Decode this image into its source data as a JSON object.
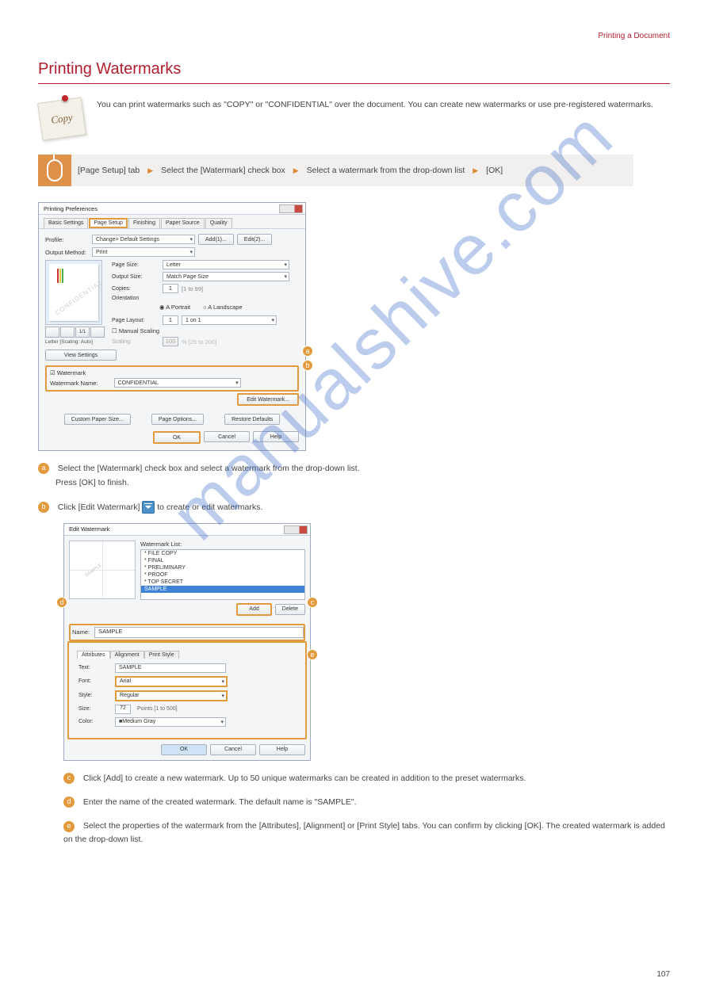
{
  "top_text": "Printing a Document",
  "pagenum": "107",
  "heading": "Printing Watermarks",
  "intro_paragraph": "You can print watermarks such as \"COPY\" or \"CONFIDENTIAL\" over the document. You can create new watermarks or use pre-registered watermarks.",
  "note_icon_label": "Copy",
  "steps": {
    "s1": "[Page Setup] tab",
    "s2": "Select the [Watermark] check box",
    "s3": "Select a watermark from the drop-down list",
    "s4": "[OK]"
  },
  "shot1": {
    "title": "Printing Preferences",
    "tabs": [
      "Basic Settings",
      "Page Setup",
      "Finishing",
      "Paper Source",
      "Quality"
    ],
    "profile": "Profile:",
    "profile_val": "Change> Default Settings",
    "add_btn": "Add(1)...",
    "edit_btn": "Edit(2)...",
    "output_method": "Output Method:",
    "output_val": "Print",
    "page_size": "Page Size:",
    "page_size_val": "Letter",
    "output_size": "Output Size:",
    "output_size_val": "Match Page Size",
    "copies": "Copies:",
    "copies_val": "1",
    "copies_hint": "[1 to 99]",
    "orientation": "Orientation",
    "orient_p": "Portrait",
    "orient_l": "Landscape",
    "layout": "Page Layout:",
    "layout_val": "1 on 1",
    "manual": "Manual Scaling",
    "scaling": "Scaling:",
    "scaling_val": "100",
    "scaling_hint": "% [25 to 200]",
    "scale_text": "Letter [Scaling: Auto]",
    "view_settings": "View Settings",
    "watermark_chk": "Watermark",
    "watermark_name": "Watermark Name:",
    "watermark_val": "CONFIDENTIAL",
    "edit_wm_btn": "Edit Watermark...",
    "custom_paper": "Custom Paper Size...",
    "page_options": "Page Options...",
    "restore_defaults": "Restore Defaults",
    "ok": "OK",
    "cancel": "Cancel",
    "help": "Help",
    "wm_text_in_preview": "CONFIDENTIAL"
  },
  "para_a": {
    "label": "a",
    "text1": "Select the [Watermark] check box and select a watermark from the drop-down list.",
    "text2": "Press [OK] to finish."
  },
  "para_b": {
    "label": "b",
    "text1": "Click [Edit Watermark]",
    "text2": "to create or edit watermarks."
  },
  "shot2": {
    "title": "Edit Watermark",
    "list_label": "Watermark List:",
    "items": [
      "* FILE COPY",
      "* FINAL",
      "* PRELIMINARY",
      "* PROOF",
      "* TOP SECRET",
      "SAMPLE"
    ],
    "add": "Add",
    "delete": "Delete",
    "name_lbl": "Name:",
    "name_val": "SAMPLE",
    "tabs": [
      "Attributes",
      "Alignment",
      "Print Style"
    ],
    "text_lbl": "Text:",
    "text_val": "SAMPLE",
    "font_lbl": "Font:",
    "font_val": "Arial",
    "style_lbl": "Style:",
    "style_val": "Regular",
    "size_lbl": "Size:",
    "size_val": "72",
    "size_hint": "Points [1 to 500]",
    "color_lbl": "Color:",
    "color_val": "Medium Gray",
    "ok": "OK",
    "cancel": "Cancel",
    "help": "Help"
  },
  "para_c": {
    "label": "c",
    "text": "Click [Add] to create a new watermark. Up to 50 unique watermarks can be created in addition to the preset watermarks."
  },
  "para_d": {
    "label": "d",
    "text": "Enter the name of the created watermark. The default name is \"SAMPLE\"."
  },
  "para_e": {
    "label": "e",
    "text": "Select the properties of the watermark from the [Attributes], [Alignment] or [Print Style] tabs. You can confirm by clicking [OK]. The created watermark is added on the drop-down list."
  },
  "watermark_url": "manualshive.com"
}
